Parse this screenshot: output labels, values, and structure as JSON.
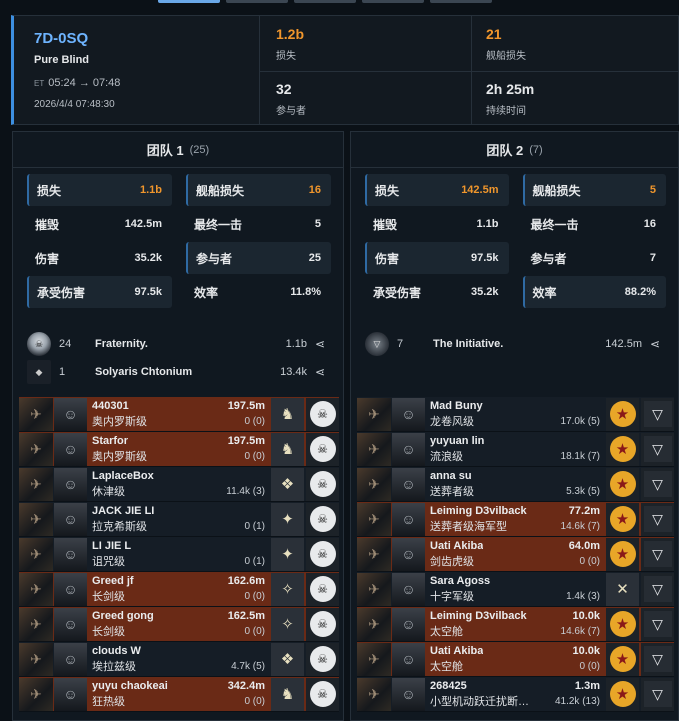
{
  "summary": {
    "system": "7D-0SQ",
    "region": "Pure Blind",
    "time_prefix": "ET",
    "time_range": "05:24 → 07:48",
    "date": "2026/4/4 07:48:30",
    "isk_lost": "1.2b",
    "isk_lost_label": "损失",
    "ships_lost": "21",
    "ships_lost_label": "舰船损失",
    "pilots": "32",
    "pilots_label": "参与者",
    "duration": "2h 25m",
    "duration_label": "持续时间",
    "colors": {
      "accent": "#6eb4ff",
      "orange": "#f0962c",
      "red_row": "#6a2a16"
    }
  },
  "team1": {
    "title": "团队 1",
    "count": "(25)",
    "stats": [
      {
        "label": "损失",
        "value": "1.1b",
        "highlight": true,
        "orange": true
      },
      {
        "label": "舰船损失",
        "value": "16",
        "highlight": true,
        "orange": true
      },
      {
        "label": "摧毁",
        "value": "142.5m"
      },
      {
        "label": "最终一击",
        "value": "5"
      },
      {
        "label": "伤害",
        "value": "35.2k"
      },
      {
        "label": "参与者",
        "value": "25",
        "highlight": true
      },
      {
        "label": "承受伤害",
        "value": "97.5k",
        "highlight": true
      },
      {
        "label": "效率",
        "value": "11.8%"
      }
    ],
    "corps": [
      {
        "count": "24",
        "name": "Fraternity.",
        "isk": "1.1b",
        "icon": "fraternity-logo"
      },
      {
        "count": "1",
        "name": "Solyaris Chtonium",
        "isk": "13.4k",
        "icon": "solyaris-logo"
      }
    ],
    "pilots": [
      {
        "name": "440301",
        "ship": "奥内罗斯级",
        "dmg": "197.5m",
        "kb": "0 (0)",
        "lost": true,
        "corp_icon": "gold-horse-icon",
        "ally_icon": "skull-icon"
      },
      {
        "name": "Starfor",
        "ship": "奥内罗斯级",
        "dmg": "197.5m",
        "kb": "0 (0)",
        "lost": true,
        "corp_icon": "red-horse-icon",
        "ally_icon": "skull-icon"
      },
      {
        "name": "LaplaceBox",
        "ship": "休津级",
        "dmg": "",
        "kb": "11.4k (3)",
        "lost": false,
        "corp_icon": "blue-wing-icon",
        "ally_icon": "skull-icon"
      },
      {
        "name": "JACK JIE LI",
        "ship": "拉克希斯级",
        "dmg": "",
        "kb": "0 (1)",
        "lost": false,
        "corp_icon": "gold-emblem-icon",
        "ally_icon": "skull-icon"
      },
      {
        "name": "LI JIE L",
        "ship": "诅咒级",
        "dmg": "",
        "kb": "0 (1)",
        "lost": false,
        "corp_icon": "gold-emblem-icon",
        "ally_icon": "skull-icon"
      },
      {
        "name": "Greed jf",
        "ship": "长剑级",
        "dmg": "162.6m",
        "kb": "0 (0)",
        "lost": true,
        "corp_icon": "dark-emblem-icon",
        "ally_icon": "skull-icon"
      },
      {
        "name": "Greed gong",
        "ship": "长剑级",
        "dmg": "162.5m",
        "kb": "0 (0)",
        "lost": true,
        "corp_icon": "dark-emblem-icon",
        "ally_icon": "skull-icon"
      },
      {
        "name": "clouds W",
        "ship": "埃拉兹级",
        "dmg": "",
        "kb": "4.7k (5)",
        "lost": false,
        "corp_icon": "blue-wing-icon",
        "ally_icon": "skull-icon"
      },
      {
        "name": "yuyu chaokeai",
        "ship": "狂热级",
        "dmg": "342.4m",
        "kb": "0 (0)",
        "lost": true,
        "corp_icon": "gold-horse-icon",
        "ally_icon": "skull-icon"
      }
    ]
  },
  "team2": {
    "title": "团队 2",
    "count": "(7)",
    "stats": [
      {
        "label": "损失",
        "value": "142.5m",
        "highlight": true,
        "orange": true
      },
      {
        "label": "舰船损失",
        "value": "5",
        "highlight": true,
        "orange": true
      },
      {
        "label": "摧毁",
        "value": "1.1b"
      },
      {
        "label": "最终一击",
        "value": "16"
      },
      {
        "label": "伤害",
        "value": "97.5k",
        "highlight": true
      },
      {
        "label": "参与者",
        "value": "7"
      },
      {
        "label": "承受伤害",
        "value": "35.2k"
      },
      {
        "label": "效率",
        "value": "88.2%",
        "highlight": true
      }
    ],
    "corps": [
      {
        "count": "7",
        "name": "The Initiative.",
        "isk": "142.5m",
        "icon": "initiative-logo"
      }
    ],
    "pilots": [
      {
        "name": "Mad Buny",
        "ship": "龙卷风级",
        "dmg": "",
        "kb": "17.0k (5)",
        "lost": false,
        "corp_icon": "star-icon",
        "ally_icon": "initiative-icon"
      },
      {
        "name": "yuyuan lin",
        "ship": "流浪级",
        "dmg": "",
        "kb": "18.1k (7)",
        "lost": false,
        "corp_icon": "star-icon",
        "ally_icon": "initiative-icon"
      },
      {
        "name": "anna su",
        "ship": "送葬者级",
        "dmg": "",
        "kb": "5.3k (5)",
        "lost": false,
        "corp_icon": "star-icon",
        "ally_icon": "initiative-icon"
      },
      {
        "name": "Leiming D3vilback",
        "ship": "送葬者级海军型",
        "dmg": "77.2m",
        "kb": "14.6k (7)",
        "lost": true,
        "corp_icon": "star-icon",
        "ally_icon": "initiative-icon"
      },
      {
        "name": "Uati Akiba",
        "ship": "剑齿虎级",
        "dmg": "64.0m",
        "kb": "0 (0)",
        "lost": true,
        "corp_icon": "star-icon",
        "ally_icon": "initiative-icon"
      },
      {
        "name": "Sara Agoss",
        "ship": "十字军级",
        "dmg": "",
        "kb": "1.4k (3)",
        "lost": false,
        "corp_icon": "crossed-swords-icon",
        "ally_icon": "initiative-icon"
      },
      {
        "name": "Leiming D3vilback",
        "ship": "太空舱",
        "dmg": "10.0k",
        "kb": "14.6k (7)",
        "lost": true,
        "corp_icon": "star-icon",
        "ally_icon": "initiative-icon"
      },
      {
        "name": "Uati Akiba",
        "ship": "太空舱",
        "dmg": "10.0k",
        "kb": "0 (0)",
        "lost": true,
        "corp_icon": "star-icon",
        "ally_icon": "initiative-icon"
      },
      {
        "name": "268425",
        "ship": "小型机动跃迁扰断…",
        "dmg": "1.3m",
        "kb": "41.2k (13)",
        "lost": false,
        "corp_icon": "star-icon",
        "ally_icon": "initiative-icon"
      }
    ]
  }
}
